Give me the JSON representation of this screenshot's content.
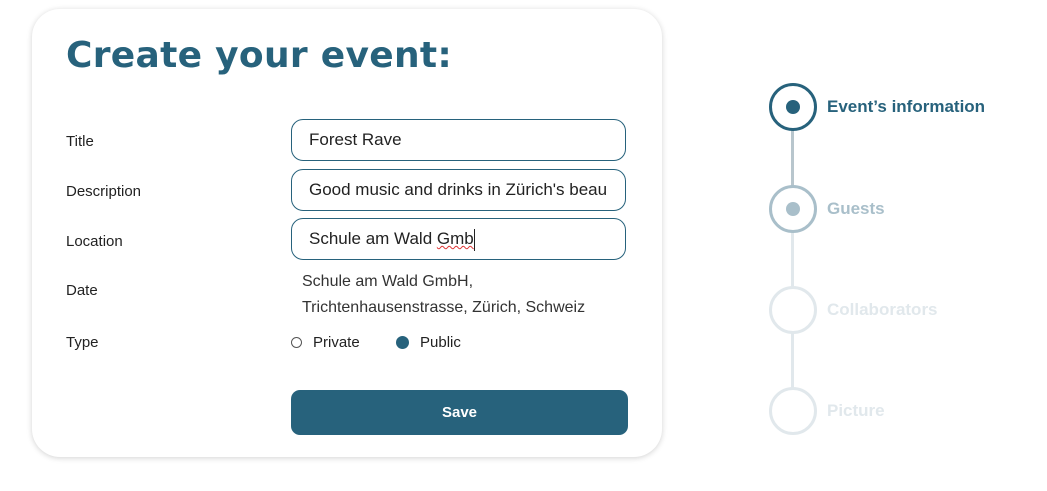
{
  "form": {
    "heading": "Create your event:",
    "labels": {
      "title": "Title",
      "description": "Description",
      "location": "Location",
      "date": "Date",
      "type": "Type"
    },
    "title_value": "Forest Rave",
    "description_value": "Good music and drinks in Zürich's beau",
    "location_value_prefix": "Schule am Wald ",
    "location_value_misspelled": "Gmb",
    "location_suggestion": {
      "line1": "Schule am Wald GmbH,",
      "line2": "Trichtenhausenstrasse, Zürich, Schweiz"
    },
    "type_options": [
      {
        "label": "Private",
        "selected": false
      },
      {
        "label": "Public",
        "selected": true
      }
    ],
    "save_label": "Save"
  },
  "steps": [
    {
      "label": "Event’s information",
      "state": "active",
      "color": "#27627c"
    },
    {
      "label": "Guests",
      "state": "next",
      "color": "#a9bfca"
    },
    {
      "label": "Collaborators",
      "state": "inactive",
      "color": "#e1e8ec"
    },
    {
      "label": "Picture",
      "state": "inactive",
      "color": "#e1e8ec"
    }
  ],
  "colors": {
    "primary": "#27627c"
  }
}
